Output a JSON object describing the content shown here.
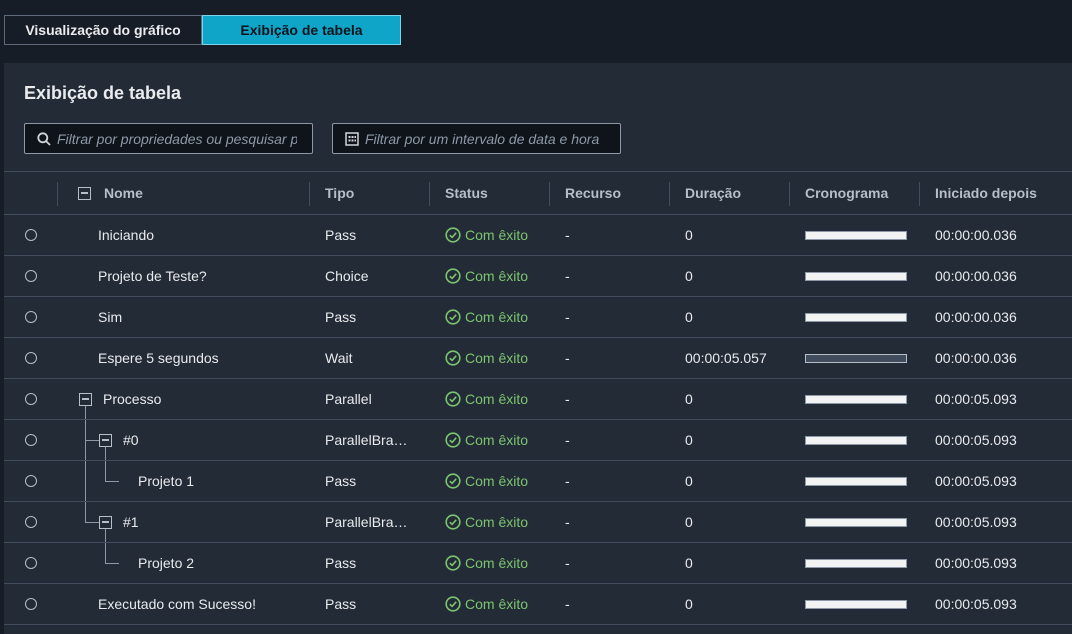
{
  "tabs": [
    {
      "label": "Visualização do gráfico"
    },
    {
      "label": "Exibição de tabela"
    }
  ],
  "panel": {
    "title": "Exibição de tabela",
    "filter_props_placeholder": "Filtrar por propriedades ou pesquisar po",
    "filter_date_placeholder": "Filtrar por um intervalo de data e hora"
  },
  "columns": {
    "name": "Nome",
    "type": "Tipo",
    "status": "Status",
    "resource": "Recurso",
    "duration": "Duração",
    "timeline": "Cronograma",
    "started_after": "Iniciado depois"
  },
  "rows": [
    {
      "name": "Iniciando",
      "type": "Pass",
      "status": "Com êxito",
      "resource": "-",
      "duration": "0",
      "started_after": "00:00:00.036"
    },
    {
      "name": "Projeto de Teste?",
      "type": "Choice",
      "status": "Com êxito",
      "resource": "-",
      "duration": "0",
      "started_after": "00:00:00.036"
    },
    {
      "name": "Sim",
      "type": "Pass",
      "status": "Com êxito",
      "resource": "-",
      "duration": "0",
      "started_after": "00:00:00.036"
    },
    {
      "name": "Espere 5 segundos",
      "type": "Wait",
      "status": "Com êxito",
      "resource": "-",
      "duration": "00:00:05.057",
      "started_after": "00:00:00.036"
    },
    {
      "name": "Processo",
      "type": "Parallel",
      "status": "Com êxito",
      "resource": "-",
      "duration": "0",
      "started_after": "00:00:05.093"
    },
    {
      "name": "#0",
      "type": "ParallelBra…",
      "status": "Com êxito",
      "resource": "-",
      "duration": "0",
      "started_after": "00:00:05.093"
    },
    {
      "name": "Projeto 1",
      "type": "Pass",
      "status": "Com êxito",
      "resource": "-",
      "duration": "0",
      "started_after": "00:00:05.093"
    },
    {
      "name": "#1",
      "type": "ParallelBra…",
      "status": "Com êxito",
      "resource": "-",
      "duration": "0",
      "started_after": "00:00:05.093"
    },
    {
      "name": "Projeto 2",
      "type": "Pass",
      "status": "Com êxito",
      "resource": "-",
      "duration": "0",
      "started_after": "00:00:05.093"
    },
    {
      "name": "Executado com Sucesso!",
      "type": "Pass",
      "status": "Com êxito",
      "resource": "-",
      "duration": "0",
      "started_after": "00:00:05.093"
    }
  ],
  "icons": {
    "search": "search-icon",
    "calendar": "calendar-icon",
    "status": "check-circle-icon",
    "collapse": "collapse-minus-icon"
  },
  "colors": {
    "accent_tab": "#0ea5c9",
    "success": "#7cc56f",
    "panel_bg": "#232b37",
    "page_bg": "#161d26"
  }
}
